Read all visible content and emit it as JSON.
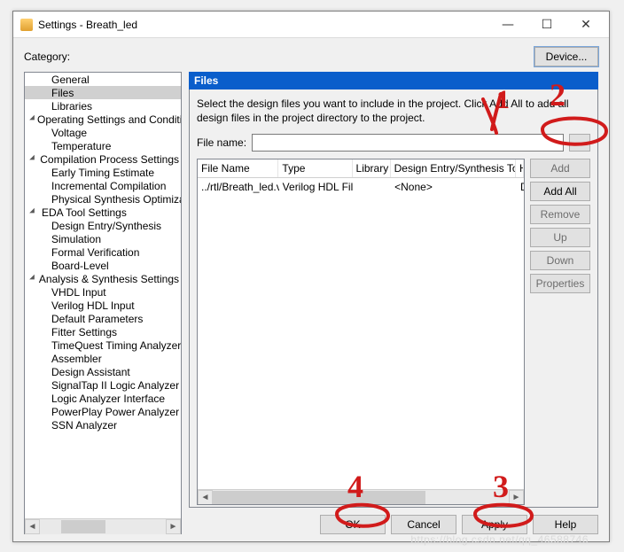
{
  "window": {
    "title": "Settings - Breath_led"
  },
  "category_label": "Category:",
  "device_button": "Device...",
  "tree": {
    "items": [
      {
        "label": "General",
        "level": 1,
        "expander": false
      },
      {
        "label": "Files",
        "level": 1,
        "expander": false,
        "selected": true
      },
      {
        "label": "Libraries",
        "level": 1,
        "expander": false
      },
      {
        "label": "Operating Settings and Conditions",
        "level": 0,
        "expander": true
      },
      {
        "label": "Voltage",
        "level": 1,
        "expander": false
      },
      {
        "label": "Temperature",
        "level": 1,
        "expander": false
      },
      {
        "label": "Compilation Process Settings",
        "level": 0,
        "expander": true
      },
      {
        "label": "Early Timing Estimate",
        "level": 1,
        "expander": false
      },
      {
        "label": "Incremental Compilation",
        "level": 1,
        "expander": false
      },
      {
        "label": "Physical Synthesis Optimization",
        "level": 1,
        "expander": false
      },
      {
        "label": "EDA Tool Settings",
        "level": 0,
        "expander": true
      },
      {
        "label": "Design Entry/Synthesis",
        "level": 1,
        "expander": false
      },
      {
        "label": "Simulation",
        "level": 1,
        "expander": false
      },
      {
        "label": "Formal Verification",
        "level": 1,
        "expander": false
      },
      {
        "label": "Board-Level",
        "level": 1,
        "expander": false
      },
      {
        "label": "Analysis & Synthesis Settings",
        "level": 0,
        "expander": true
      },
      {
        "label": "VHDL Input",
        "level": 1,
        "expander": false
      },
      {
        "label": "Verilog HDL Input",
        "level": 1,
        "expander": false
      },
      {
        "label": "Default Parameters",
        "level": 1,
        "expander": false
      },
      {
        "label": "Fitter Settings",
        "level": 1,
        "expander": false
      },
      {
        "label": "TimeQuest Timing Analyzer",
        "level": 1,
        "expander": false
      },
      {
        "label": "Assembler",
        "level": 1,
        "expander": false
      },
      {
        "label": "Design Assistant",
        "level": 1,
        "expander": false
      },
      {
        "label": "SignalTap II Logic Analyzer",
        "level": 1,
        "expander": false
      },
      {
        "label": "Logic Analyzer Interface",
        "level": 1,
        "expander": false
      },
      {
        "label": "PowerPlay Power Analyzer Settings",
        "level": 1,
        "expander": false
      },
      {
        "label": "SSN Analyzer",
        "level": 1,
        "expander": false
      }
    ]
  },
  "panel": {
    "header": "Files",
    "description": "Select the design files you want to include in the project. Click Add All to add all design files in the project directory to the project.",
    "filename_label": "File name:",
    "filename_value": "",
    "browse_label": "...",
    "columns": {
      "fn": "File Name",
      "type": "Type",
      "lib": "Library",
      "de": "Design Entry/Synthesis Tool",
      "h": "H"
    },
    "rows": [
      {
        "fn": "../rtl/Breath_led.v",
        "type": "Verilog HDL File",
        "lib": "",
        "de": "<None>",
        "h": "D"
      }
    ],
    "side_buttons": {
      "add": "Add",
      "addall": "Add All",
      "remove": "Remove",
      "up": "Up",
      "down": "Down",
      "props": "Properties"
    }
  },
  "bottom": {
    "ok": "OK",
    "cancel": "Cancel",
    "apply": "Apply",
    "help": "Help"
  },
  "watermark": "https://blog.csdn.net/qq_46588746"
}
